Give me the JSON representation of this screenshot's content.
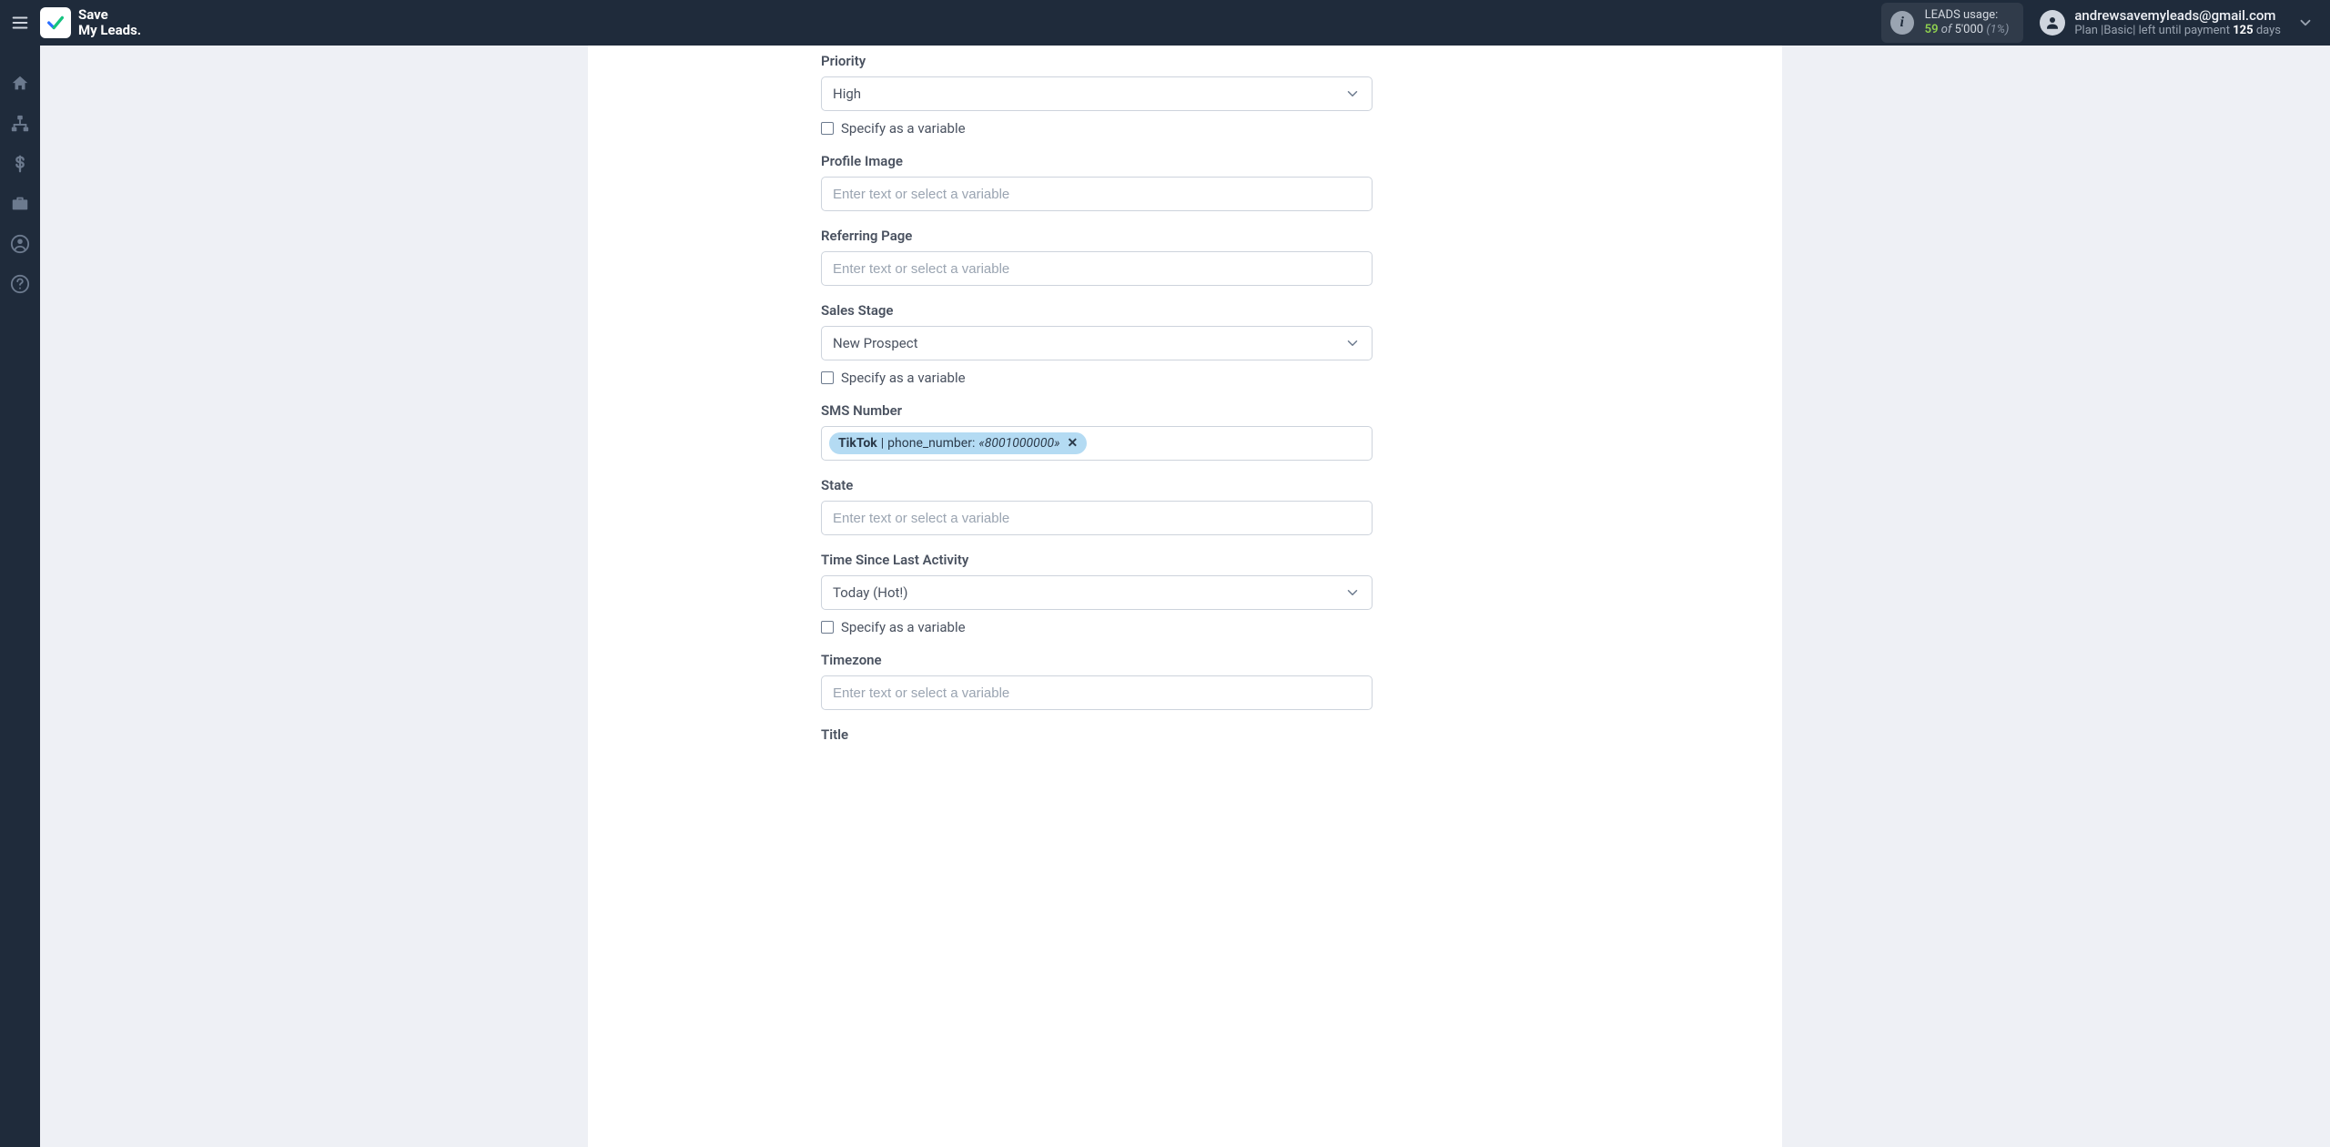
{
  "brand": {
    "line1": "Save",
    "line2": "My Leads."
  },
  "usage": {
    "label": "LEADS usage:",
    "used": "59",
    "of_word": "of",
    "total": "5'000",
    "percent": "(1%)"
  },
  "user": {
    "email": "andrewsavemyleads@gmail.com",
    "plan_prefix": "Plan |",
    "plan_name": "Basic",
    "plan_sep": "| left until payment",
    "days_num": "125",
    "days_word": "days"
  },
  "form": {
    "placeholder": "Enter text or select a variable",
    "variable_label": "Specify as a variable",
    "fields": {
      "priority": {
        "label": "Priority",
        "value": "High"
      },
      "profile_image": {
        "label": "Profile Image"
      },
      "referring_page": {
        "label": "Referring Page"
      },
      "sales_stage": {
        "label": "Sales Stage",
        "value": "New Prospect"
      },
      "sms_number": {
        "label": "SMS Number",
        "pill": {
          "source": "TikTok",
          "field": "phone_number:",
          "value": "«8001000000»"
        }
      },
      "state": {
        "label": "State"
      },
      "time_since": {
        "label": "Time Since Last Activity",
        "value": "Today (Hot!)"
      },
      "timezone": {
        "label": "Timezone"
      },
      "title": {
        "label": "Title"
      }
    }
  }
}
